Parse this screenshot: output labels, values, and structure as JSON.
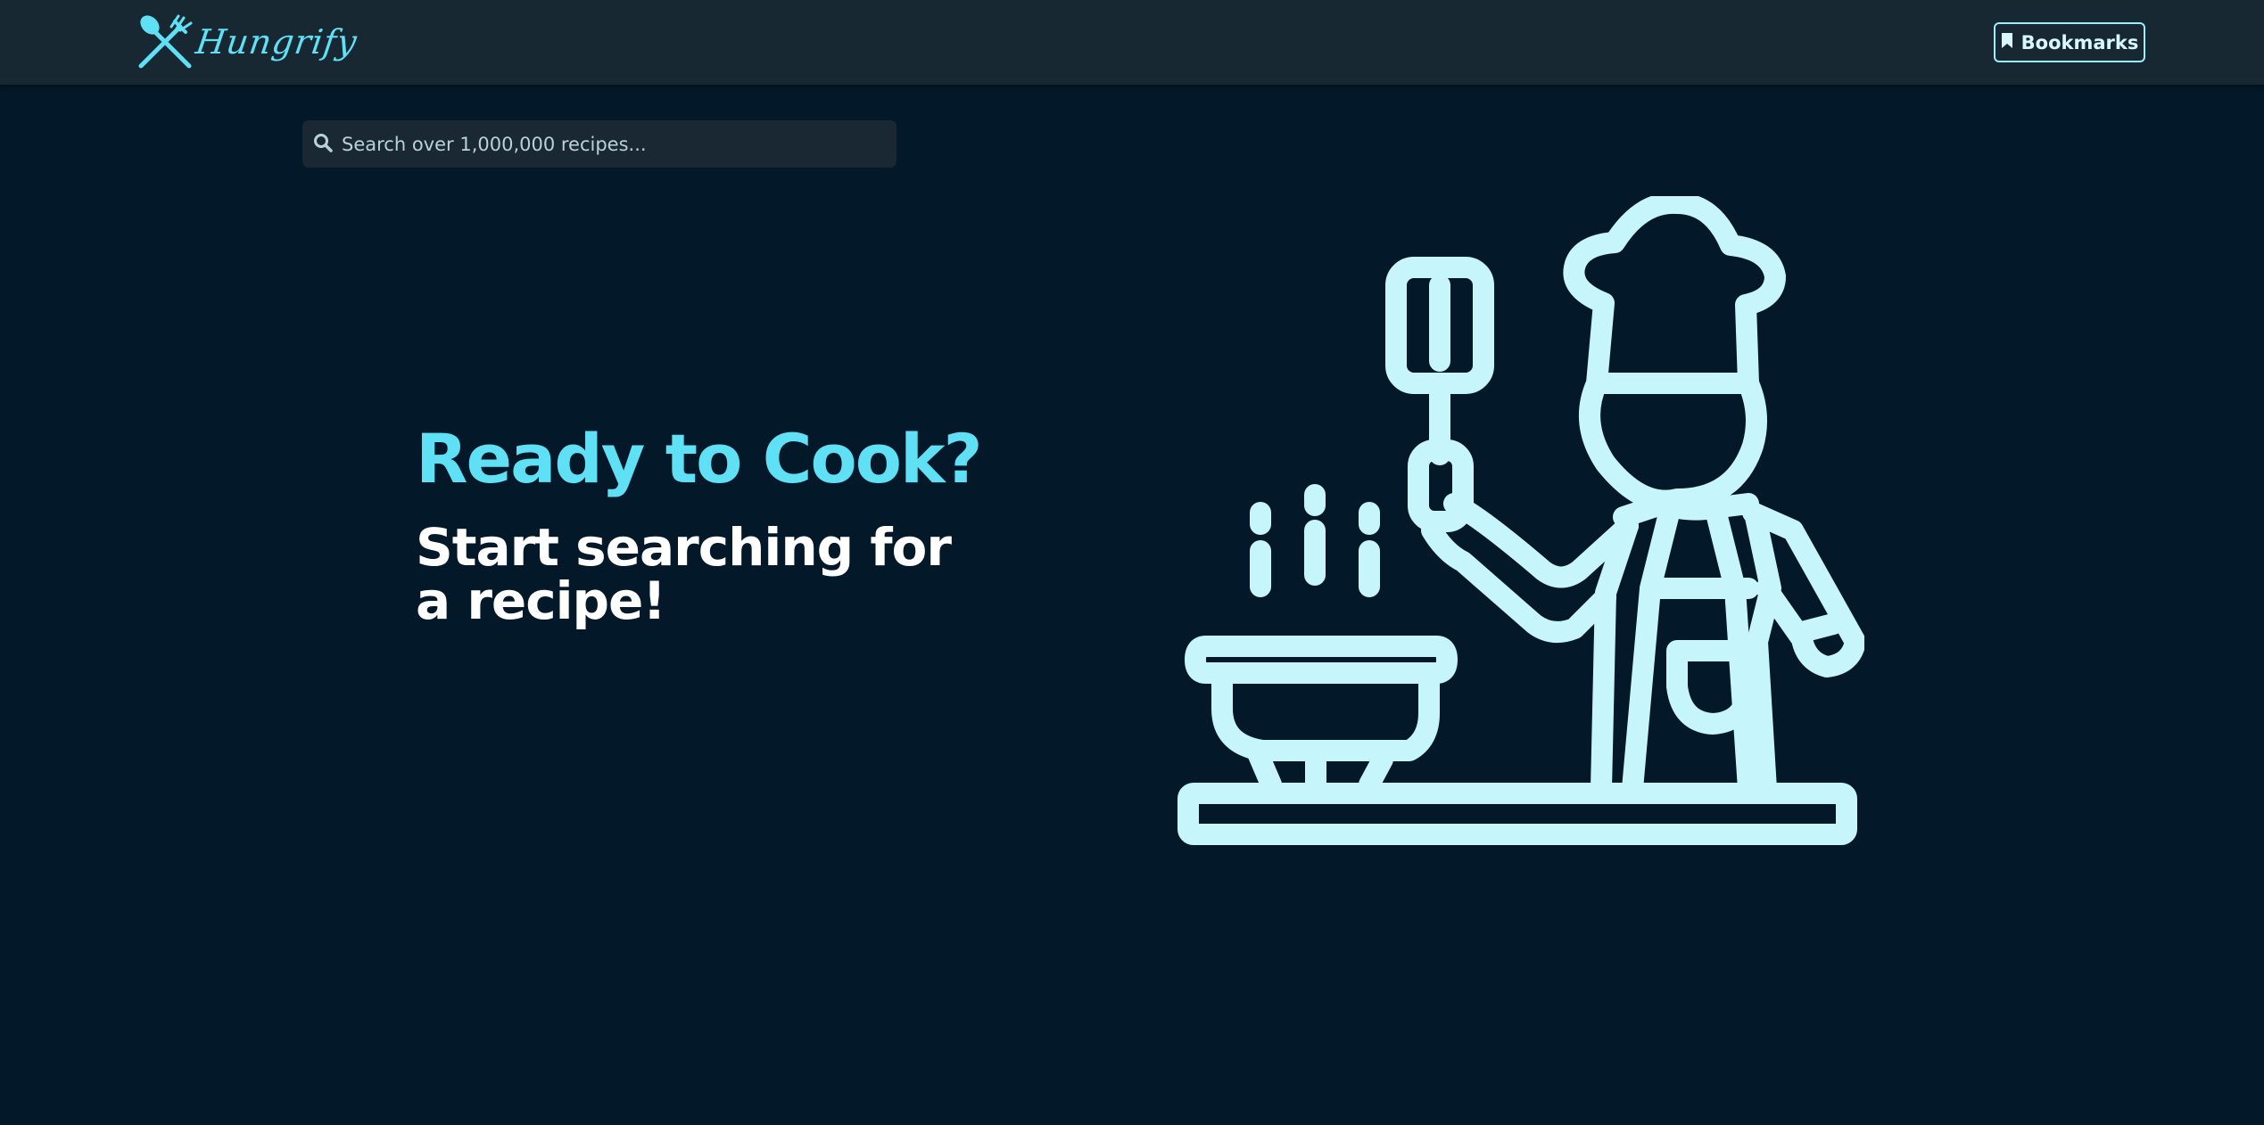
{
  "navbar": {
    "logo_text": "Hungrify",
    "logo_icon": "spoon-fork-crossed-icon",
    "bookmarks_label": "Bookmarks",
    "bookmarks_icon": "bookmark-icon"
  },
  "search": {
    "icon": "search-icon",
    "placeholder": "Search over 1,000,000 recipes...",
    "value": ""
  },
  "hero": {
    "title": "Ready to Cook?",
    "subtitle": "Start searching for a recipe!",
    "illustration_icon": "chef-cooking-icon"
  },
  "colors": {
    "background": "#031828",
    "navbar": "#182833",
    "accent": "#5fe0f5",
    "illustration": "#c6f6fb",
    "text": "#ffffff"
  }
}
